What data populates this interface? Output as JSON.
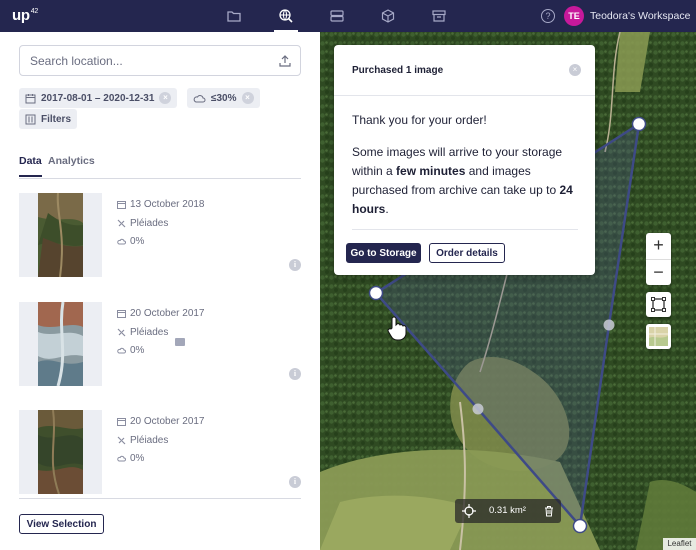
{
  "app": {
    "logo_text": "up",
    "logo_sup": "42",
    "workspace_initials": "TE",
    "workspace_name": "Teodora's Workspace",
    "help_label": "?",
    "colors": {
      "navy": "#24264f",
      "avatar": "#c8199b"
    },
    "nav_icons": [
      "folder-icon",
      "globe-search-icon",
      "storage-icon",
      "cube-icon",
      "archive-box-icon"
    ]
  },
  "sidebar": {
    "search_placeholder": "Search location...",
    "date_chip": "2017-08-01 – 2020-12-31",
    "cloud_chip": "≤30%",
    "chip_remove": "×",
    "filters_label": "Filters",
    "tabs": [
      {
        "label": "Data",
        "active": true
      },
      {
        "label": "Analytics",
        "active": false
      }
    ],
    "results": [
      {
        "date": "13 October 2018",
        "sensor": "Pléiades",
        "cloud": "0%",
        "archived": false
      },
      {
        "date": "20 October 2017",
        "sensor": "Pléiades",
        "cloud": "0%",
        "archived": true
      },
      {
        "date": "20 October 2017",
        "sensor": "Pléiades",
        "cloud": "0%",
        "archived": false
      }
    ],
    "info_label": "i",
    "view_selection_label": "View Selection"
  },
  "modal": {
    "title": "Purchased 1 image",
    "close_label": "×",
    "thanks": "Thank you for your order!",
    "body_part1": "Some images will arrive to your storage within a ",
    "body_bold1": "few minutes",
    "body_part2": " and images purchased from archive can take up to ",
    "body_bold2": "24 hours",
    "body_part3": ".",
    "primary_button": "Go to Storage",
    "secondary_button": "Order details"
  },
  "map": {
    "zoom_in": "+",
    "zoom_out": "−",
    "area_value": "0.31 km²",
    "attribution": "Leaflet"
  }
}
